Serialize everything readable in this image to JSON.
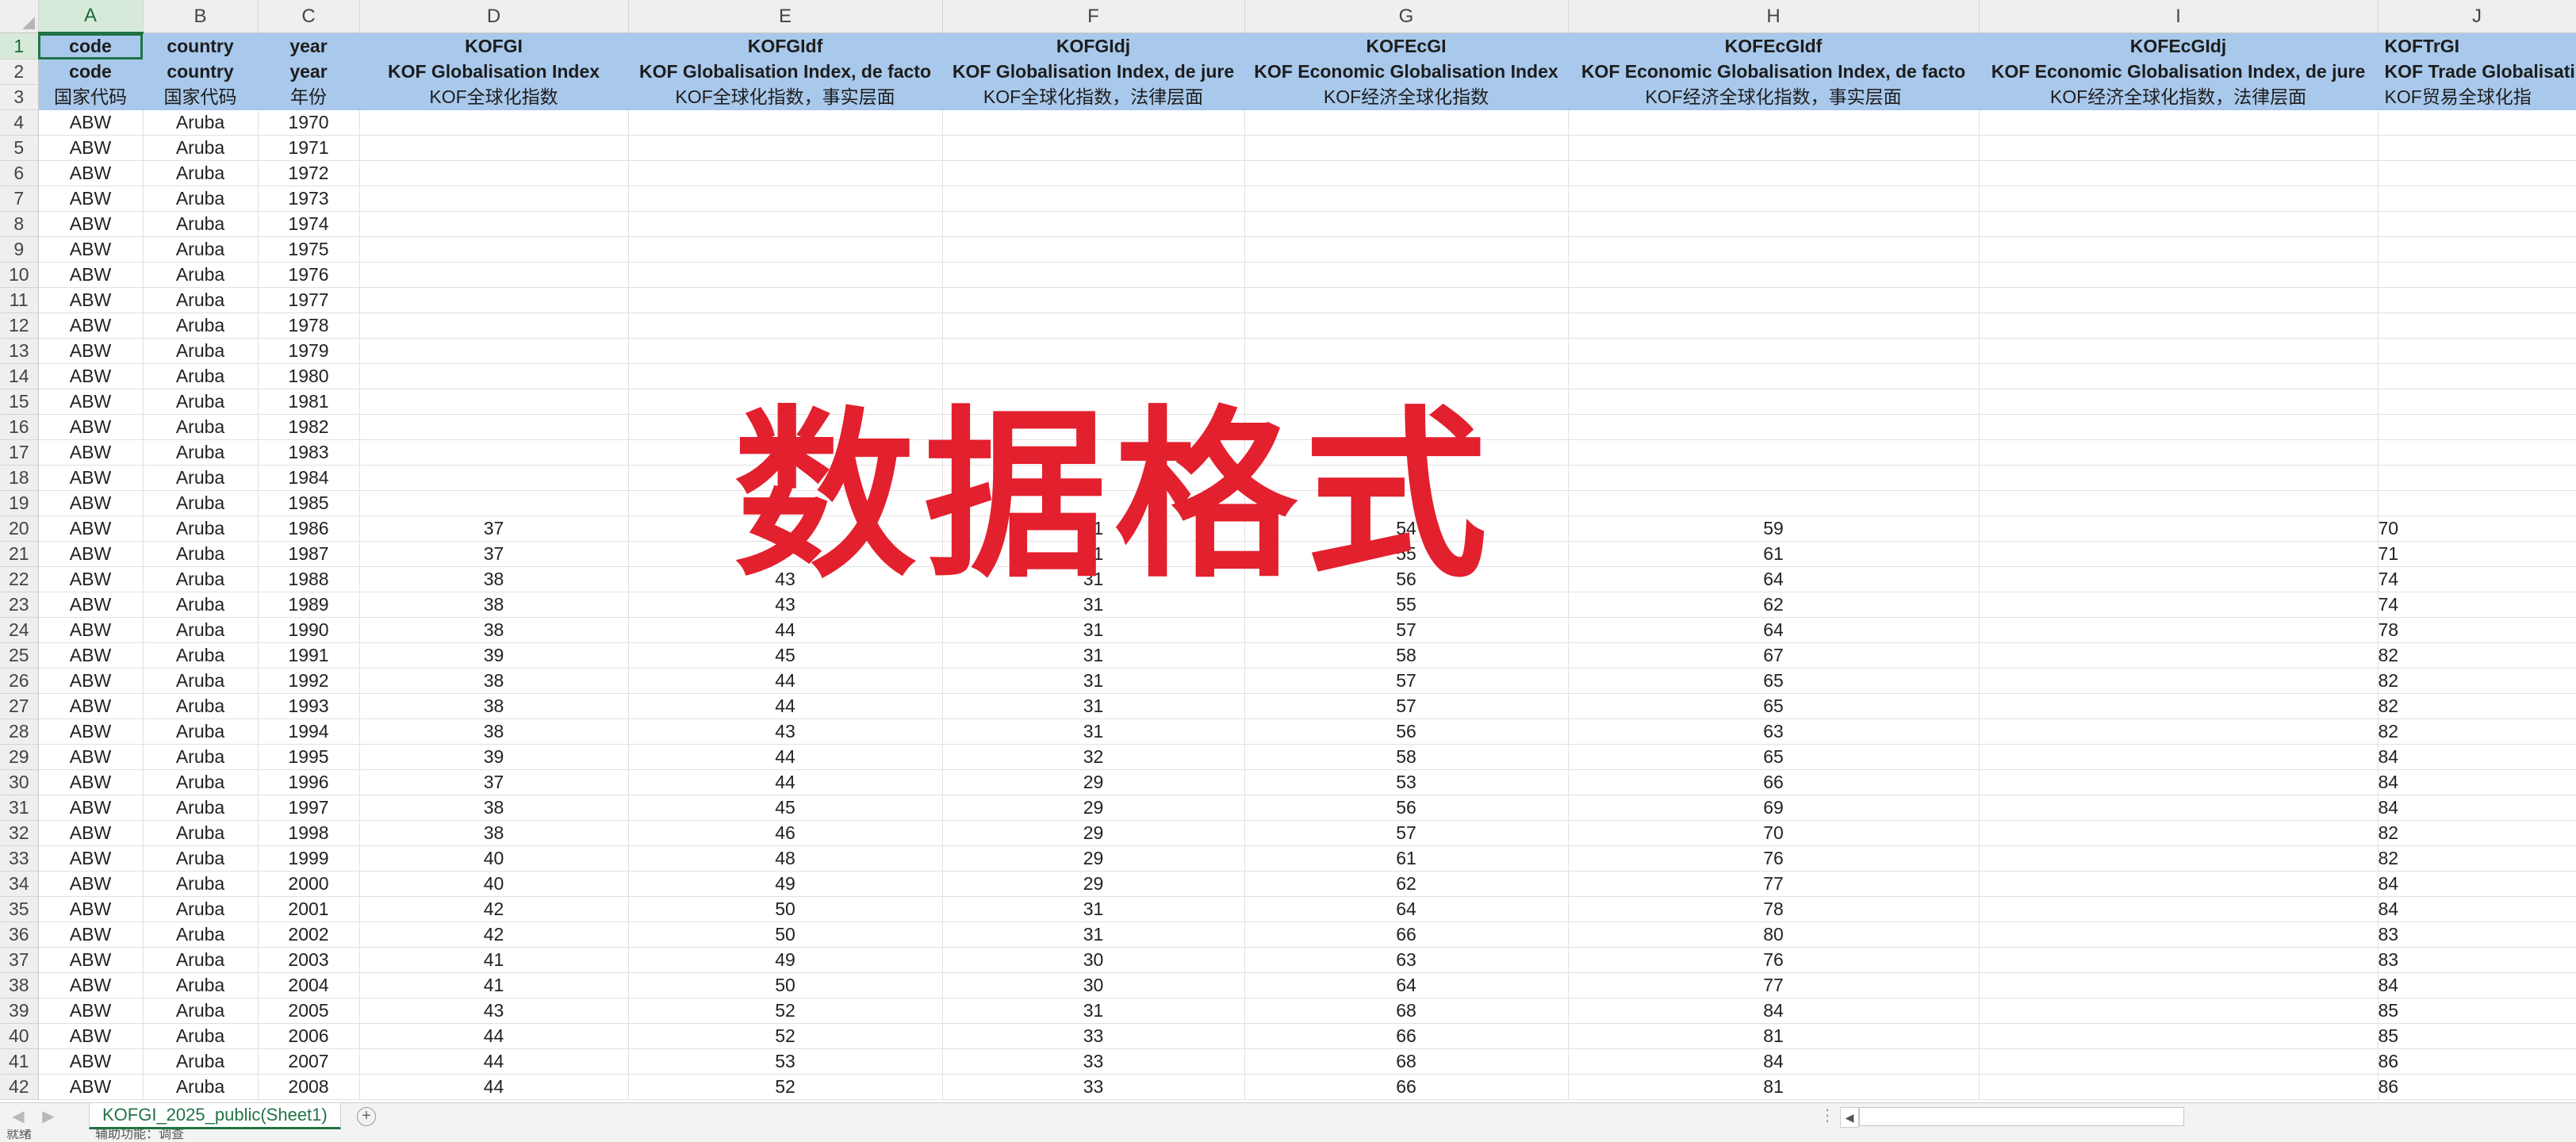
{
  "columns": [
    "A",
    "B",
    "C",
    "D",
    "E",
    "F",
    "G",
    "H",
    "I",
    "J"
  ],
  "selected_cell": "A1",
  "header_rows": [
    [
      "code",
      "country",
      "year",
      "KOFGI",
      "KOFGIdf",
      "KOFGIdj",
      "KOFEcGI",
      "KOFEcGIdf",
      "KOFEcGIdj",
      "KOFTrGI"
    ],
    [
      "code",
      "country",
      "year",
      "KOF Globalisation Index",
      "KOF Globalisation Index, de facto",
      "KOF Globalisation Index, de jure",
      "KOF Economic Globalisation Index",
      "KOF Economic Globalisation Index, de facto",
      "KOF Economic Globalisation Index, de jure",
      "KOF Trade Globalisati"
    ],
    [
      "国家代码",
      "国家代码",
      "年份",
      "KOF全球化指数",
      "KOF全球化指数，事实层面",
      "KOF全球化指数，法律层面",
      "KOF经济全球化指数",
      "KOF经济全球化指数，事实层面",
      "KOF经济全球化指数，法律层面",
      "KOF贸易全球化指"
    ]
  ],
  "data_rows": [
    [
      "ABW",
      "Aruba",
      "1970",
      "",
      "",
      "",
      "",
      "",
      "",
      ""
    ],
    [
      "ABW",
      "Aruba",
      "1971",
      "",
      "",
      "",
      "",
      "",
      "",
      ""
    ],
    [
      "ABW",
      "Aruba",
      "1972",
      "",
      "",
      "",
      "",
      "",
      "",
      ""
    ],
    [
      "ABW",
      "Aruba",
      "1973",
      "",
      "",
      "",
      "",
      "",
      "",
      ""
    ],
    [
      "ABW",
      "Aruba",
      "1974",
      "",
      "",
      "",
      "",
      "",
      "",
      ""
    ],
    [
      "ABW",
      "Aruba",
      "1975",
      "",
      "",
      "",
      "",
      "",
      "",
      ""
    ],
    [
      "ABW",
      "Aruba",
      "1976",
      "",
      "",
      "",
      "",
      "",
      "",
      ""
    ],
    [
      "ABW",
      "Aruba",
      "1977",
      "",
      "",
      "",
      "",
      "",
      "",
      ""
    ],
    [
      "ABW",
      "Aruba",
      "1978",
      "",
      "",
      "",
      "",
      "",
      "",
      ""
    ],
    [
      "ABW",
      "Aruba",
      "1979",
      "",
      "",
      "",
      "",
      "",
      "",
      ""
    ],
    [
      "ABW",
      "Aruba",
      "1980",
      "",
      "",
      "",
      "",
      "",
      "",
      ""
    ],
    [
      "ABW",
      "Aruba",
      "1981",
      "",
      "",
      "",
      "",
      "",
      "",
      ""
    ],
    [
      "ABW",
      "Aruba",
      "1982",
      "",
      "",
      "",
      "",
      "",
      "",
      ""
    ],
    [
      "ABW",
      "Aruba",
      "1983",
      "",
      "",
      "",
      "",
      "",
      "",
      ""
    ],
    [
      "ABW",
      "Aruba",
      "1984",
      "",
      "",
      "",
      "",
      "",
      "",
      ""
    ],
    [
      "ABW",
      "Aruba",
      "1985",
      "",
      "",
      "",
      "",
      "",
      "",
      ""
    ],
    [
      "ABW",
      "Aruba",
      "1986",
      "37",
      "",
      "31",
      "54",
      "59",
      "",
      "70"
    ],
    [
      "ABW",
      "Aruba",
      "1987",
      "37",
      "",
      "31",
      "55",
      "61",
      "",
      "71"
    ],
    [
      "ABW",
      "Aruba",
      "1988",
      "38",
      "43",
      "31",
      "56",
      "64",
      "",
      "74"
    ],
    [
      "ABW",
      "Aruba",
      "1989",
      "38",
      "43",
      "31",
      "55",
      "62",
      "",
      "74"
    ],
    [
      "ABW",
      "Aruba",
      "1990",
      "38",
      "44",
      "31",
      "57",
      "64",
      "",
      "78"
    ],
    [
      "ABW",
      "Aruba",
      "1991",
      "39",
      "45",
      "31",
      "58",
      "67",
      "",
      "82"
    ],
    [
      "ABW",
      "Aruba",
      "1992",
      "38",
      "44",
      "31",
      "57",
      "65",
      "",
      "82"
    ],
    [
      "ABW",
      "Aruba",
      "1993",
      "38",
      "44",
      "31",
      "57",
      "65",
      "",
      "82"
    ],
    [
      "ABW",
      "Aruba",
      "1994",
      "38",
      "43",
      "31",
      "56",
      "63",
      "",
      "82"
    ],
    [
      "ABW",
      "Aruba",
      "1995",
      "39",
      "44",
      "32",
      "58",
      "65",
      "",
      "84"
    ],
    [
      "ABW",
      "Aruba",
      "1996",
      "37",
      "44",
      "29",
      "53",
      "66",
      "",
      "84"
    ],
    [
      "ABW",
      "Aruba",
      "1997",
      "38",
      "45",
      "29",
      "56",
      "69",
      "",
      "84"
    ],
    [
      "ABW",
      "Aruba",
      "1998",
      "38",
      "46",
      "29",
      "57",
      "70",
      "",
      "82"
    ],
    [
      "ABW",
      "Aruba",
      "1999",
      "40",
      "48",
      "29",
      "61",
      "76",
      "",
      "82"
    ],
    [
      "ABW",
      "Aruba",
      "2000",
      "40",
      "49",
      "29",
      "62",
      "77",
      "",
      "84"
    ],
    [
      "ABW",
      "Aruba",
      "2001",
      "42",
      "50",
      "31",
      "64",
      "78",
      "",
      "84"
    ],
    [
      "ABW",
      "Aruba",
      "2002",
      "42",
      "50",
      "31",
      "66",
      "80",
      "",
      "83"
    ],
    [
      "ABW",
      "Aruba",
      "2003",
      "41",
      "49",
      "30",
      "63",
      "76",
      "",
      "83"
    ],
    [
      "ABW",
      "Aruba",
      "2004",
      "41",
      "50",
      "30",
      "64",
      "77",
      "",
      "84"
    ],
    [
      "ABW",
      "Aruba",
      "2005",
      "43",
      "52",
      "31",
      "68",
      "84",
      "",
      "85"
    ],
    [
      "ABW",
      "Aruba",
      "2006",
      "44",
      "52",
      "33",
      "66",
      "81",
      "",
      "85"
    ],
    [
      "ABW",
      "Aruba",
      "2007",
      "44",
      "53",
      "33",
      "68",
      "84",
      "",
      "86"
    ],
    [
      "ABW",
      "Aruba",
      "2008",
      "44",
      "52",
      "33",
      "66",
      "81",
      "",
      "86"
    ]
  ],
  "watermark": "数据格式",
  "sheet_tab": "KOFGI_2025_public(Sheet1)",
  "add_sheet_label": "+",
  "nav_prev": "◀",
  "nav_next": "▶",
  "hscroll_left": "◀",
  "hscroll_dots": "⋮",
  "status": {
    "ready": "就绪",
    "accessibility": "辅助功能：调查"
  }
}
